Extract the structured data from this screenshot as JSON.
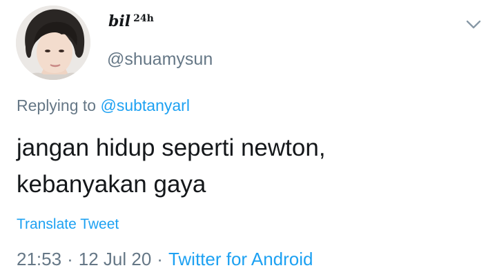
{
  "tweet": {
    "author": {
      "display_name": "bil",
      "display_name_suffix": "24h",
      "handle": "@shuamysun"
    },
    "reply_prefix": "Replying to",
    "reply_to": "@subtanyarl",
    "text_line1": "jangan hidup seperti newton,",
    "text_line2": "kebanyakan gaya",
    "translate_label": "Translate Tweet",
    "time": "21:53",
    "separator": "·",
    "date": "12 Jul 20",
    "source": "Twitter for Android"
  },
  "icons": {
    "avatar": "profile-photo",
    "menu": "chevron-down-icon"
  },
  "colors": {
    "text": "#14171a",
    "secondary": "#657786",
    "link": "#1da1f2"
  }
}
